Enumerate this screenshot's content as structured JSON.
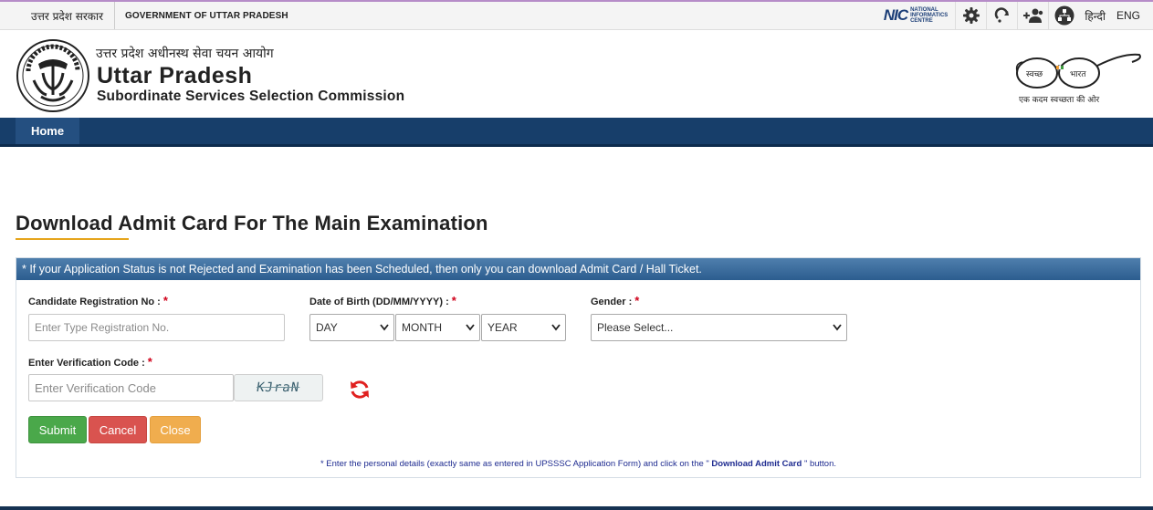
{
  "topbar": {
    "state_hindi": "उत्तर प्रदेश सरकार",
    "state_english": "GOVERNMENT OF UTTAR PRADESH",
    "nic_mark": "NIC",
    "nic_line1": "NATIONAL",
    "nic_line2": "INFORMATICS",
    "nic_line3": "CENTRE",
    "icons": [
      "gear-icon",
      "redo-icon",
      "add-people-icon",
      "sitemap-icon"
    ],
    "lang_hindi": "हिन्दी",
    "lang_english": "ENG"
  },
  "header": {
    "org_hindi": "उत्तर प्रदेश अधीनस्थ सेवा चयन आयोग",
    "title": "Uttar Pradesh",
    "subtitle": "Subordinate Services Selection Commission",
    "swachh_left": "स्वच्छ",
    "swachh_right": "भारत",
    "swachh_tagline": "एक कदम स्वच्छता की ओर"
  },
  "nav": {
    "home": "Home"
  },
  "page": {
    "title": "Download Admit Card For The Main Examination",
    "notice": "* If your Application Status is not Rejected and Examination has been Scheduled, then only you can download Admit Card / Hall Ticket."
  },
  "form": {
    "reg_label": "Candidate Registration No :",
    "reg_placeholder": "Enter Type Registration No.",
    "dob_label": "Date of Birth (DD/MM/YYYY) :",
    "day_value": "DAY",
    "month_value": "MONTH",
    "year_value": "YEAR",
    "gender_label": "Gender :",
    "gender_value": "Please Select...",
    "code_label": "Enter Verification Code :",
    "code_placeholder": "Enter Verification Code",
    "captcha_text": "KJraN",
    "required_mark": "*",
    "submit": "Submit",
    "cancel": "Cancel",
    "close": "Close",
    "note_prefix": "* Enter the personal details (exactly same as entered in UPSSSC Application Form) and click on the \"",
    "note_bold": "Download Admit Card",
    "note_suffix": "\" button."
  },
  "colors": {
    "nav_bg": "#173e6a",
    "panel_head": "#2c5d8f",
    "submit": "#4aa84a",
    "cancel": "#d9534f",
    "close": "#f0ad4e",
    "accent_underline": "#e6a51d"
  }
}
